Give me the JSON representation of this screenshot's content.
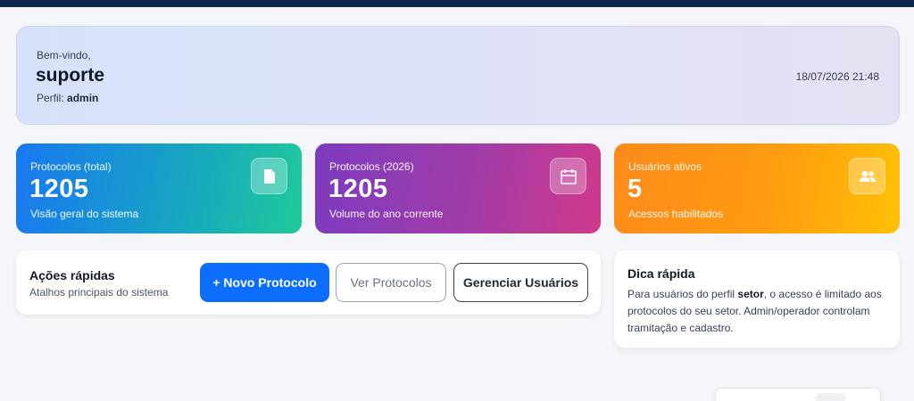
{
  "welcome": {
    "greeting": "Bem-vindo,",
    "username": "suporte",
    "profile_label": "Perfil:",
    "profile_value": "admin",
    "datetime": "18/07/2026 21:48"
  },
  "stats": [
    {
      "label": "Protocolos (total)",
      "value": "1205",
      "sub": "Visão geral do sistema",
      "icon": "document-icon"
    },
    {
      "label": "Protocolos (2026)",
      "value": "1205",
      "sub": "Volume do ano corrente",
      "icon": "calendar-icon"
    },
    {
      "label": "Usuários ativos",
      "value": "5",
      "sub": "Acessos habilitados",
      "icon": "users-icon"
    }
  ],
  "quick_actions": {
    "title": "Ações rápidas",
    "subtitle": "Atalhos principais do sistema",
    "buttons": {
      "new_protocol": "+ Novo Protocolo",
      "view_protocols": "Ver Protocolos",
      "manage_users": "Gerenciar Usuários"
    }
  },
  "tip": {
    "title": "Dica rápida",
    "text_before": "Para usuários do perfil ",
    "highlight": "setor",
    "text_after": ", o acesso é limitado aos protocolos do seu setor. Admin/operador controlam tramitação e cadastro."
  },
  "colors": {
    "topbar": "#0f2549",
    "primary": "#0d6efd",
    "card_total": "#1978f2",
    "card_year": "#a13ca8",
    "card_users": "#ff9c10"
  }
}
